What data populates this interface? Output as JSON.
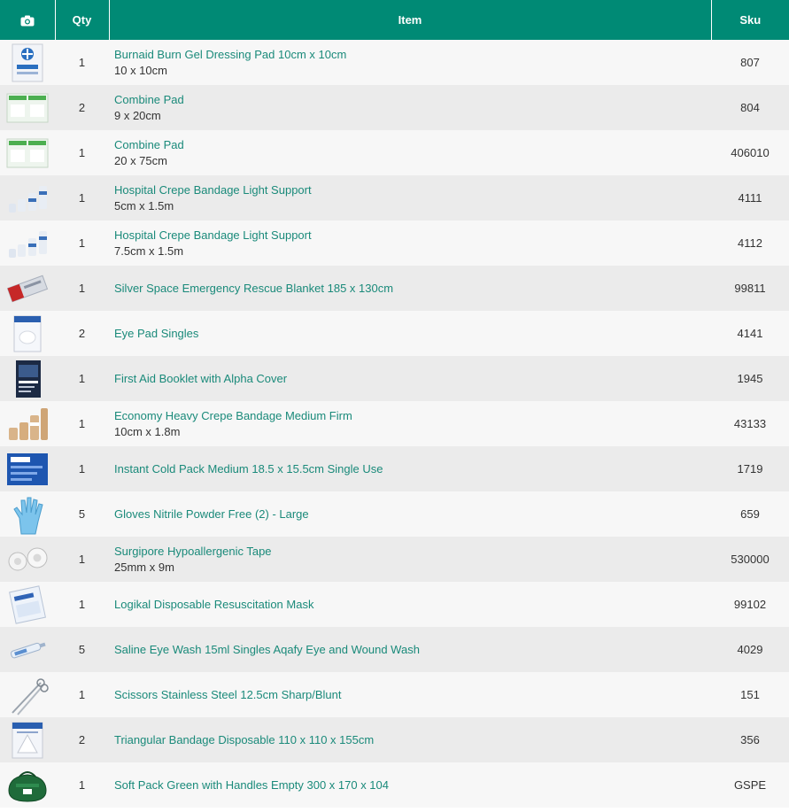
{
  "header": {
    "photo_icon": "camera-icon",
    "qty_label": "Qty",
    "item_label": "Item",
    "sku_label": "Sku"
  },
  "rows": [
    {
      "qty": "1",
      "name": "Burnaid Burn Gel Dressing Pad 10cm x 10cm",
      "size": "10 x 10cm",
      "sku": "807",
      "thumb": "burn-gel-pack"
    },
    {
      "qty": "2",
      "name": "Combine Pad",
      "size": "9 x 20cm",
      "sku": "804",
      "thumb": "combine-pad-pack"
    },
    {
      "qty": "1",
      "name": "Combine Pad",
      "size": "20 x 75cm",
      "sku": "406010",
      "thumb": "combine-pad-pack"
    },
    {
      "qty": "1",
      "name": "Hospital Crepe Bandage Light Support",
      "size": "5cm x 1.5m",
      "sku": "4111",
      "thumb": "bandage-rolls"
    },
    {
      "qty": "1",
      "name": "Hospital Crepe Bandage Light Support",
      "size": "7.5cm x 1.5m",
      "sku": "4112",
      "thumb": "bandage-rolls"
    },
    {
      "qty": "1",
      "name": "Silver Space Emergency Rescue Blanket 185 x 130cm",
      "size": "",
      "sku": "99811",
      "thumb": "space-blanket"
    },
    {
      "qty": "2",
      "name": "Eye Pad Singles",
      "size": "",
      "sku": "4141",
      "thumb": "eye-pad-pack"
    },
    {
      "qty": "1",
      "name": "First Aid Booklet with Alpha Cover",
      "size": "",
      "sku": "1945",
      "thumb": "booklet"
    },
    {
      "qty": "1",
      "name": "Economy Heavy Crepe Bandage Medium Firm",
      "size": "10cm x 1.8m",
      "sku": "43133",
      "thumb": "crepe-rolls"
    },
    {
      "qty": "1",
      "name": "Instant Cold Pack Medium 18.5 x 15.5cm Single Use",
      "size": "",
      "sku": "1719",
      "thumb": "cold-pack"
    },
    {
      "qty": "5",
      "name": "Gloves Nitrile Powder Free (2) - Large",
      "size": "",
      "sku": "659",
      "thumb": "glove"
    },
    {
      "qty": "1",
      "name": "Surgipore Hypoallergenic Tape",
      "size": "25mm x 9m",
      "sku": "530000",
      "thumb": "tape-rolls"
    },
    {
      "qty": "1",
      "name": "Logikal Disposable Resuscitation Mask",
      "size": "",
      "sku": "99102",
      "thumb": "mask-pack"
    },
    {
      "qty": "5",
      "name": "Saline Eye Wash 15ml Singles Aqafy Eye and Wound Wash",
      "size": "",
      "sku": "4029",
      "thumb": "eye-wash"
    },
    {
      "qty": "1",
      "name": "Scissors Stainless Steel 12.5cm Sharp/Blunt",
      "size": "",
      "sku": "151",
      "thumb": "scissors"
    },
    {
      "qty": "2",
      "name": "Triangular Bandage Disposable 110 x 110 x 155cm",
      "size": "",
      "sku": "356",
      "thumb": "triangular-bandage-pack"
    },
    {
      "qty": "1",
      "name": "Soft Pack Green with Handles Empty 300 x 170 x 104",
      "size": "",
      "sku": "GSPE",
      "thumb": "green-bag"
    }
  ],
  "colors": {
    "header_bg": "#008a75",
    "link": "#1a8a7a",
    "row_light": "#f7f7f7",
    "row_dark": "#ebebeb"
  }
}
